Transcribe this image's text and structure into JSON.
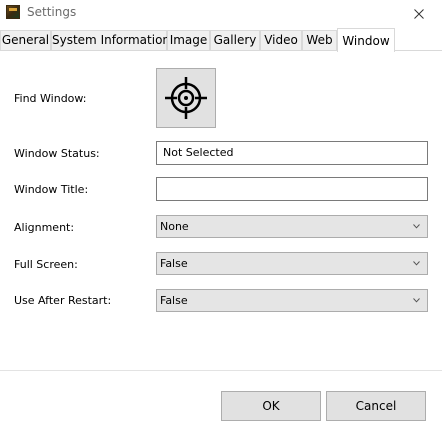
{
  "window": {
    "title": "Settings",
    "icon": "app-icon",
    "close_icon": "close-icon"
  },
  "tabs": [
    {
      "label": "General"
    },
    {
      "label": "System Information"
    },
    {
      "label": "Image"
    },
    {
      "label": "Gallery"
    },
    {
      "label": "Video"
    },
    {
      "label": "Web"
    },
    {
      "label": "Window",
      "active": true
    }
  ],
  "form": {
    "find_window": {
      "label": "Find Window:",
      "icon": "crosshair-icon"
    },
    "window_status": {
      "label": "Window Status:",
      "value": "Not Selected"
    },
    "window_title": {
      "label": "Window Title:",
      "value": ""
    },
    "alignment": {
      "label": "Alignment:",
      "value": "None"
    },
    "full_screen": {
      "label": "Full Screen:",
      "value": "False"
    },
    "use_after_restart": {
      "label": "Use After Restart:",
      "value": "False"
    }
  },
  "buttons": {
    "ok": "OK",
    "cancel": "Cancel"
  },
  "colors": {
    "button_face": "#e1e1e1",
    "combo_face": "#e5e5e5",
    "border": "#adadad",
    "title_text": "#6b6b6b"
  }
}
